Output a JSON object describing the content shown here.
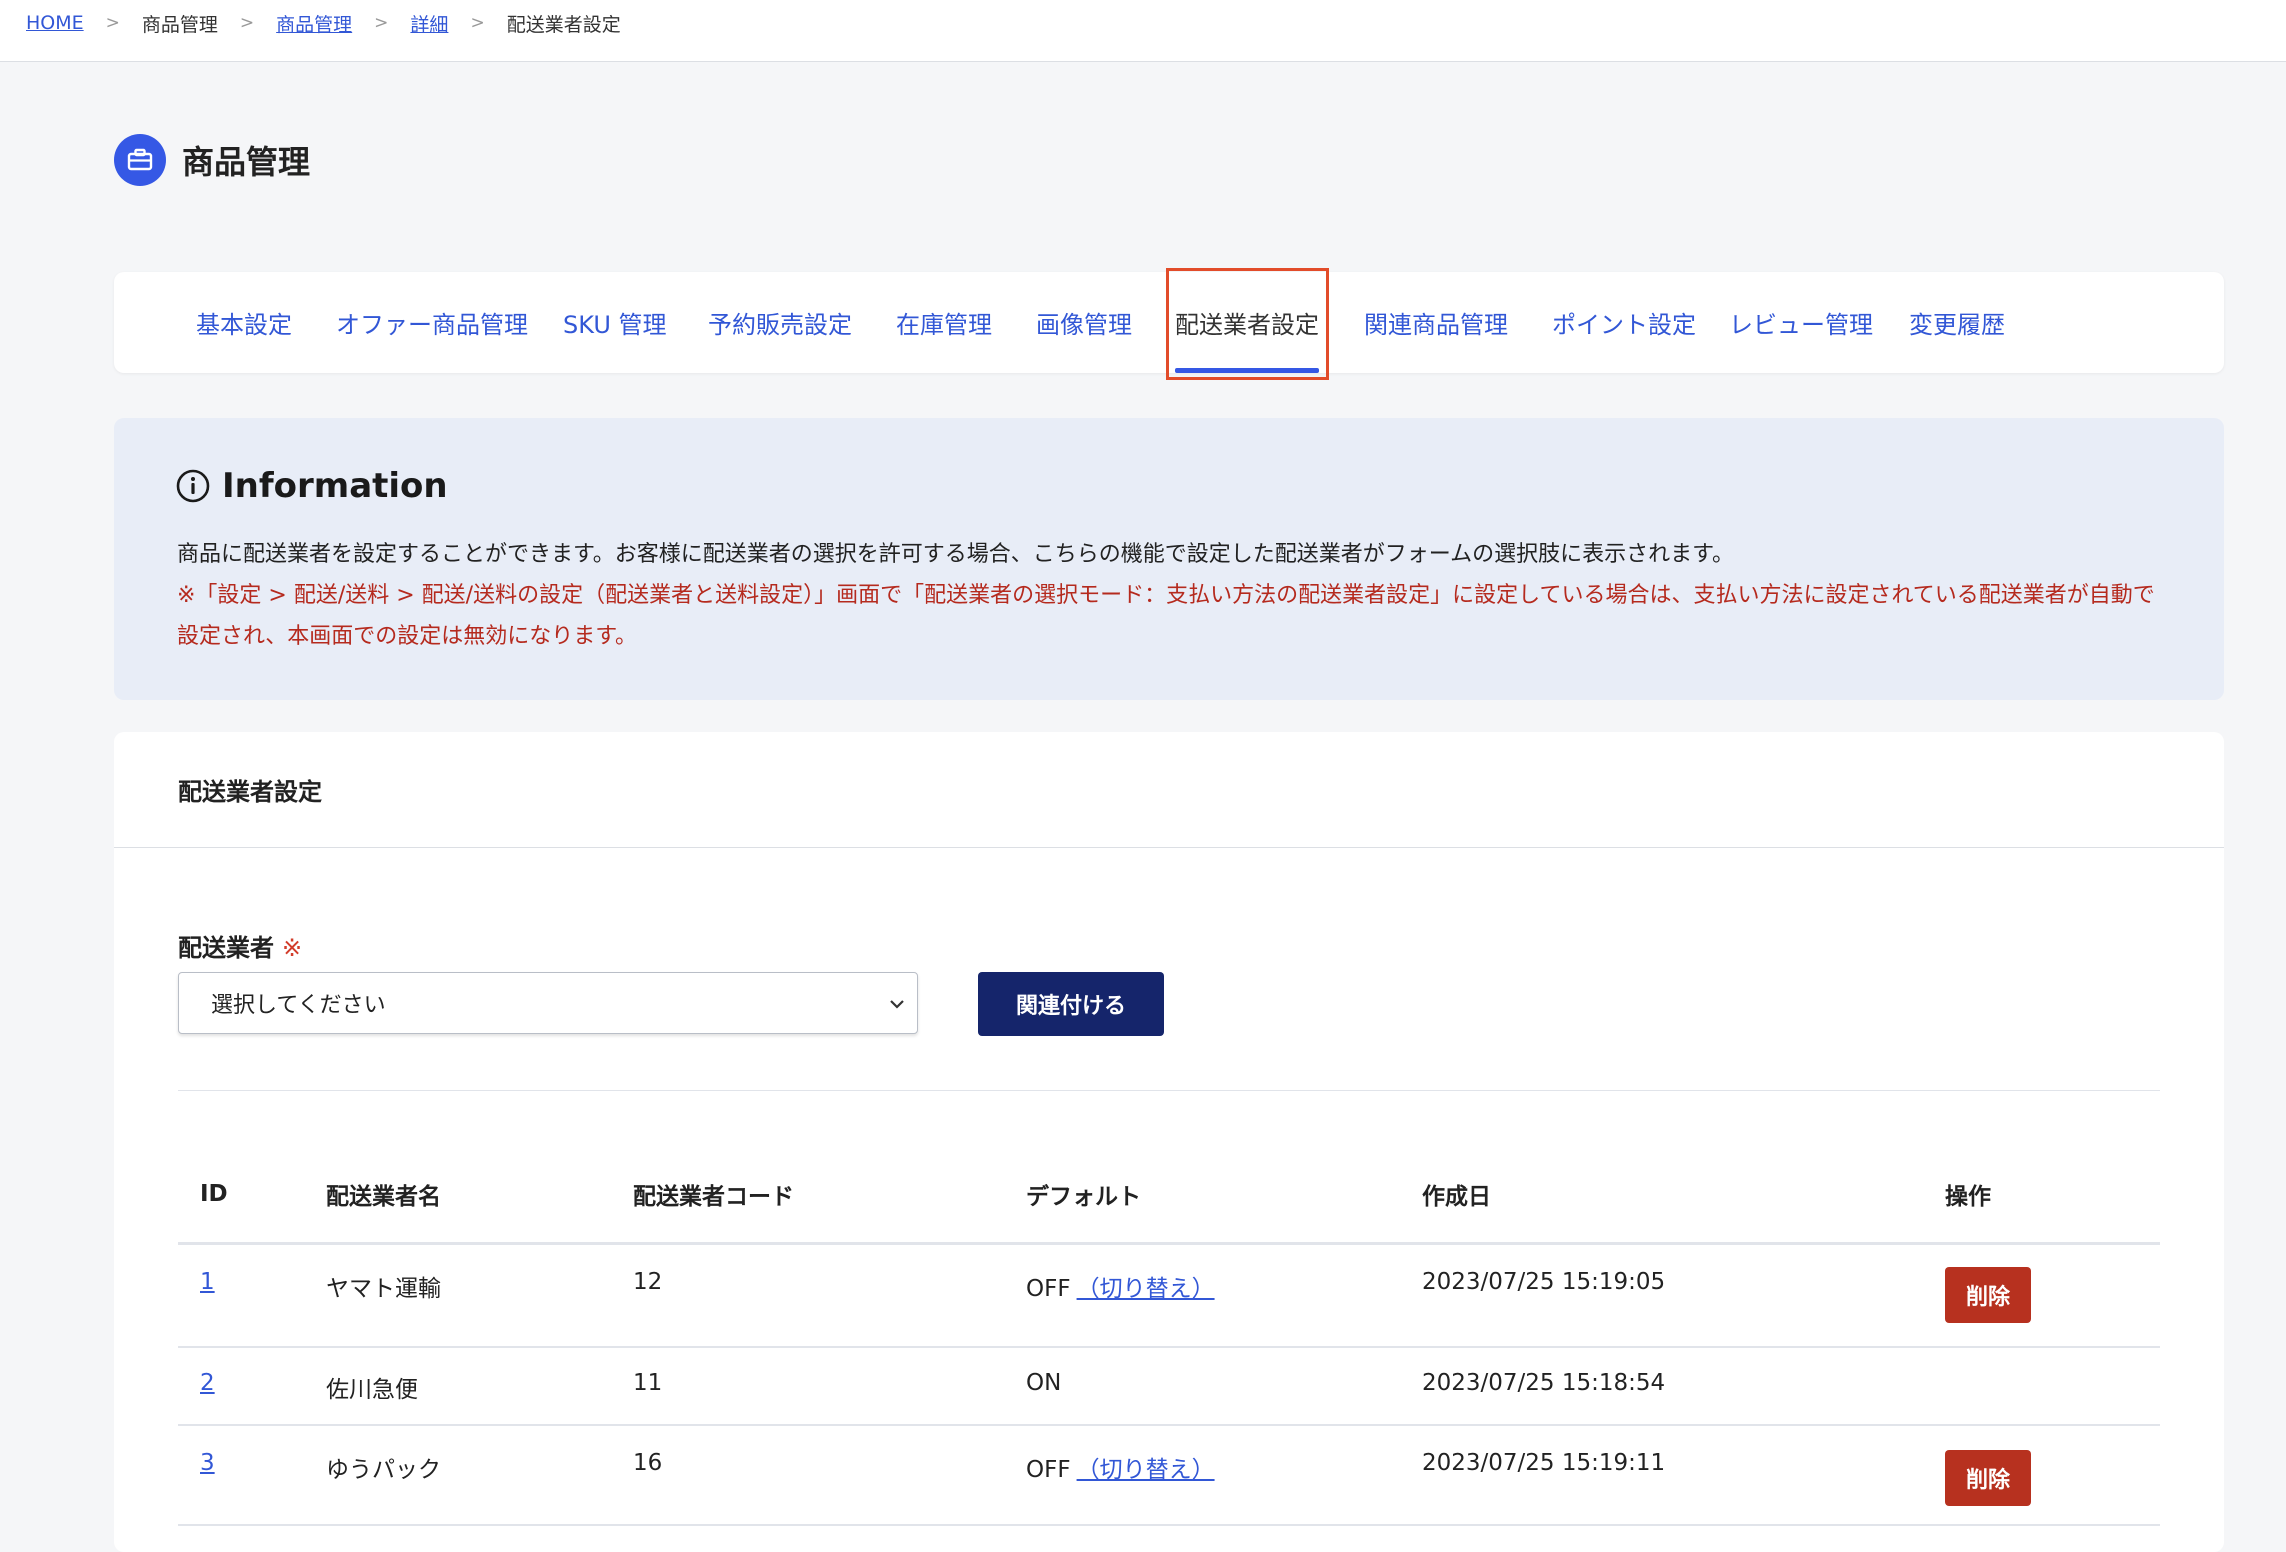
{
  "breadcrumb": {
    "home": "HOME",
    "item1": "商品管理",
    "item2": "商品管理",
    "item3": "詳細",
    "current": "配送業者設定",
    "separator": ">"
  },
  "header": {
    "title": "商品管理",
    "icon": "briefcase-icon"
  },
  "tabs": [
    {
      "label": "基本設定"
    },
    {
      "label": "オファー商品管理"
    },
    {
      "label": "SKU 管理"
    },
    {
      "label": "予約販売設定"
    },
    {
      "label": "在庫管理"
    },
    {
      "label": "画像管理"
    },
    {
      "label": "配送業者設定",
      "active": true
    },
    {
      "label": "関連商品管理"
    },
    {
      "label": "ポイント設定"
    },
    {
      "label": "レビュー管理"
    },
    {
      "label": "変更履歴"
    }
  ],
  "info": {
    "heading": "Information",
    "text": "商品に配送業者を設定することができます。お客様に配送業者の選択を許可する場合、こちらの機能で設定した配送業者がフォームの選択肢に表示されます。",
    "warning": "※「設定 > 配送/送料 > 配送/送料の設定（配送業者と送料設定）」画面で「配送業者の選択モード：支払い方法の配送業者設定」に設定している場合は、支払い方法に設定されている配送業者が自動で設定され、本画面での設定は無効になります。"
  },
  "section": {
    "title": "配送業者設定",
    "field_label": "配送業者",
    "required_mark": "※",
    "select_value": "選択してください",
    "link_button": "関連付ける"
  },
  "table": {
    "headers": {
      "id": "ID",
      "name": "配送業者名",
      "code": "配送業者コード",
      "default": "デフォルト",
      "created": "作成日",
      "action": "操作"
    },
    "rows": [
      {
        "id": "1",
        "name": "ヤマト運輸",
        "code": "12",
        "default": "OFF",
        "toggle": "（切り替え）",
        "created": "2023/07/25 15:19:05",
        "delete": "削除"
      },
      {
        "id": "2",
        "name": "佐川急便",
        "code": "11",
        "default": "ON",
        "toggle": "",
        "created": "2023/07/25 15:18:54",
        "delete": ""
      },
      {
        "id": "3",
        "name": "ゆうパック",
        "code": "16",
        "default": "OFF",
        "toggle": "（切り替え）",
        "created": "2023/07/25 15:19:11",
        "delete": "削除"
      }
    ]
  },
  "colors": {
    "accent": "#3558e5",
    "link": "#3257d6",
    "primary_button": "#15256b",
    "danger": "#b7311f",
    "warning_text": "#b52a1e",
    "highlight_box": "#e24c2a",
    "info_bg": "#e8edf7"
  }
}
